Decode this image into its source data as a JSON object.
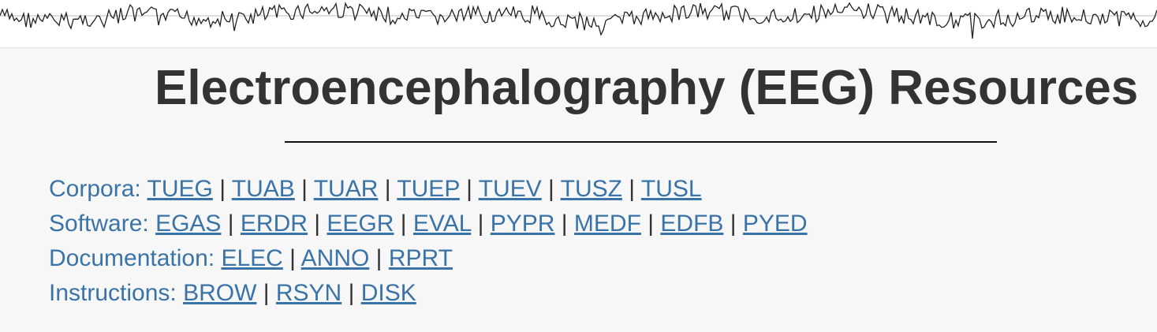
{
  "header": {
    "banner_icon": "eeg-waveform-banner",
    "title": "Electroencephalography (EEG) Resources"
  },
  "colors": {
    "link": "#3a73a8",
    "title": "#333333",
    "background": "#f7f7f7"
  },
  "nav": {
    "rows": [
      {
        "label": "Corpora:",
        "links": [
          "TUEG",
          "TUAB",
          "TUAR",
          "TUEP",
          "TUEV",
          "TUSZ",
          "TUSL"
        ]
      },
      {
        "label": "Software:",
        "links": [
          "EGAS",
          "ERDR",
          "EEGR",
          "EVAL",
          "PYPR",
          "MEDF",
          "EDFB",
          "PYED"
        ]
      },
      {
        "label": "Documentation:",
        "links": [
          "ELEC",
          "ANNO",
          "RPRT"
        ]
      },
      {
        "label": "Instructions:",
        "links": [
          "BROW",
          "RSYN",
          "DISK"
        ]
      }
    ]
  }
}
